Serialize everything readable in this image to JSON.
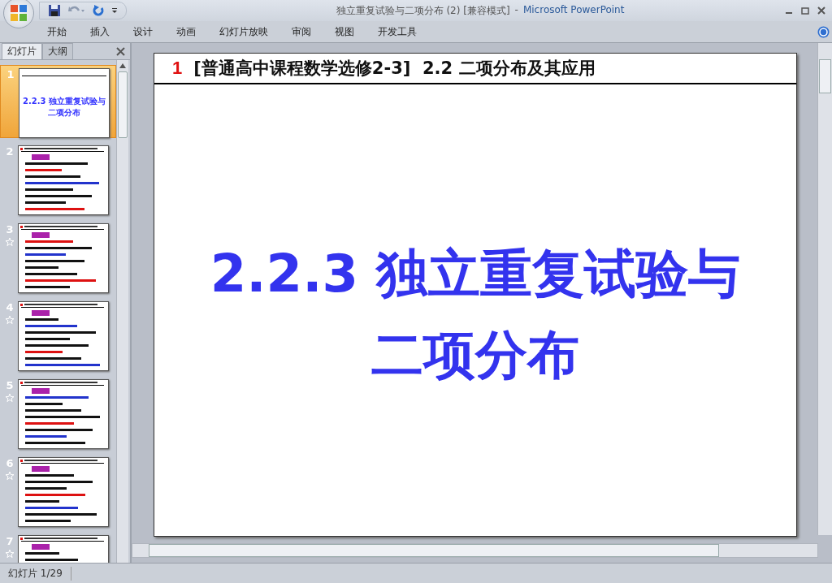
{
  "window": {
    "title": "独立重复试验与二项分布 (2) [兼容模式]",
    "separator": "-",
    "app": "Microsoft PowerPoint"
  },
  "ribbon_tabs": [
    {
      "label": "开始"
    },
    {
      "label": "插入"
    },
    {
      "label": "设计"
    },
    {
      "label": "动画"
    },
    {
      "label": "幻灯片放映"
    },
    {
      "label": "审阅"
    },
    {
      "label": "视图"
    },
    {
      "label": "开发工具"
    }
  ],
  "panel_tabs": [
    {
      "label": "幻灯片",
      "selected": true
    },
    {
      "label": "大纲",
      "selected": false
    }
  ],
  "slides": [
    {
      "number": "1",
      "selected": true,
      "animated": false,
      "kind": "title",
      "title_lines": [
        "2.2.3 独立重复试验与",
        "二项分布"
      ]
    },
    {
      "number": "2",
      "selected": false,
      "animated": false,
      "kind": "content"
    },
    {
      "number": "3",
      "selected": false,
      "animated": true,
      "kind": "content"
    },
    {
      "number": "4",
      "selected": false,
      "animated": true,
      "kind": "content"
    },
    {
      "number": "5",
      "selected": false,
      "animated": true,
      "kind": "content"
    },
    {
      "number": "6",
      "selected": false,
      "animated": true,
      "kind": "content"
    },
    {
      "number": "7",
      "selected": false,
      "animated": true,
      "kind": "content"
    }
  ],
  "slide": {
    "number": "1",
    "header": "[普通高中课程数学选修2-3]  2.2 二项分布及其应用",
    "title_lines": [
      "2.2.3 独立重复试验与",
      "二项分布"
    ]
  },
  "status_bar": {
    "slide_counter": "幻灯片 1/29"
  }
}
